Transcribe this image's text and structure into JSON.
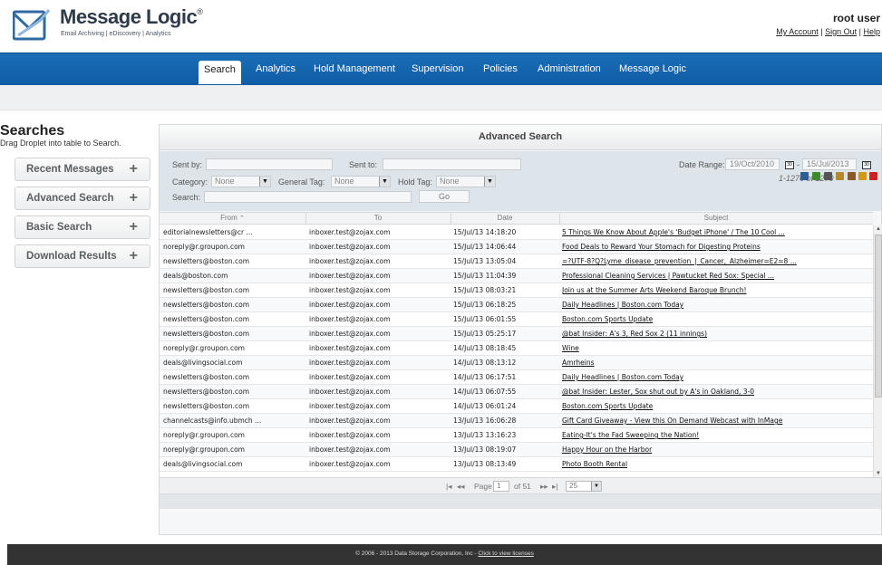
{
  "brand": {
    "title": "Message Logic",
    "trademark": "®",
    "tagline": "Email Archiving | eDiscovery | Analytics"
  },
  "user": {
    "name": "root user",
    "my_account": "My Account",
    "sign_out": "Sign Out",
    "help": "Help"
  },
  "nav": {
    "search": "Search",
    "analytics": "Analytics",
    "hold_management": "Hold Management",
    "supervision": "Supervision",
    "policies": "Policies",
    "administration": "Administration",
    "message_logic": "Message Logic"
  },
  "sidebar": {
    "title": "Searches",
    "subtitle": "Drag Droplet into table to Search.",
    "items": [
      {
        "label": "Recent Messages",
        "plus": "+"
      },
      {
        "label": "Advanced Search",
        "plus": "+"
      },
      {
        "label": "Basic Search",
        "plus": "+"
      },
      {
        "label": "Download Results",
        "plus": "+"
      }
    ]
  },
  "panel": {
    "title": "Advanced Search"
  },
  "filters": {
    "sent_by_label": "Sent by:",
    "sent_by_value": "",
    "sent_to_label": "Sent to:",
    "sent_to_value": "",
    "date_range_label": "Date Range:",
    "date_from": "19/Oct/2010",
    "date_sep": "-",
    "date_to": "15/Jul/2013",
    "category_label": "Category:",
    "category_value": "None",
    "general_tag_label": "General Tag:",
    "general_tag_value": "None",
    "hold_tag_label": "Hold Tag:",
    "hold_tag_value": "None",
    "search_label": "Search:",
    "search_value": "",
    "go_label": "Go",
    "results_count": "1-1270 of 1270",
    "calendar_icon_text": "30",
    "tool_icons": [
      {
        "name": "email-icon",
        "color": "#2a5f95"
      },
      {
        "name": "checklist-icon",
        "color": "#3d8a2e"
      },
      {
        "name": "print-icon",
        "color": "#555555"
      },
      {
        "name": "tag-icon",
        "color": "#b8862b"
      },
      {
        "name": "calendar-icon",
        "color": "#8a5a2b"
      },
      {
        "name": "refresh-icon",
        "color": "#d09a17"
      },
      {
        "name": "stop-icon",
        "color": "#cc2222"
      }
    ]
  },
  "table": {
    "columns": [
      "From",
      "To",
      "Date",
      "Subject"
    ],
    "sort_indicator": "⌃",
    "rows": [
      {
        "from": "editorialnewsletters@cr ...",
        "to": "inboxer.test@zojax.com",
        "date": "15/Jul/13 14:18:20",
        "subject": "5 Things We Know About Apple's 'Budget iPhone' / The 10 Cool ..."
      },
      {
        "from": "noreply@r.groupon.com",
        "to": "inboxer.test@zojax.com",
        "date": "15/Jul/13 14:06:44",
        "subject": "Food Deals to Reward Your Stomach for Digesting Proteins"
      },
      {
        "from": "newsletters@boston.com",
        "to": "inboxer.test@zojax.com",
        "date": "15/Jul/13 13:05:04",
        "subject": "=?UTF-8?Q?Lyme_disease_prevention_|_Cancer,_Alzheimer=E2=8 ..."
      },
      {
        "from": "deals@boston.com",
        "to": "inboxer.test@zojax.com",
        "date": "15/Jul/13 11:04:39",
        "subject": "Professional Cleaning Services | Pawtucket Red Sox: Special ..."
      },
      {
        "from": "newsletters@boston.com",
        "to": "inboxer.test@zojax.com",
        "date": "15/Jul/13 08:03:21",
        "subject": "Join us at the Summer Arts Weekend Baroque Brunch!"
      },
      {
        "from": "newsletters@boston.com",
        "to": "inboxer.test@zojax.com",
        "date": "15/Jul/13 06:18:25",
        "subject": "Daily Headlines | Boston.com Today"
      },
      {
        "from": "newsletters@boston.com",
        "to": "inboxer.test@zojax.com",
        "date": "15/Jul/13 06:01:55",
        "subject": "Boston.com Sports Update"
      },
      {
        "from": "newsletters@boston.com",
        "to": "inboxer.test@zojax.com",
        "date": "15/Jul/13 05:25:17",
        "subject": "@bat Insider: A's 3, Red Sox 2 (11 innings)"
      },
      {
        "from": "noreply@r.groupon.com",
        "to": "inboxer.test@zojax.com",
        "date": "14/Jul/13 08:18:45",
        "subject": "Wine"
      },
      {
        "from": "deals@livingsocial.com",
        "to": "inboxer.test@zojax.com",
        "date": "14/Jul/13 08:13:12",
        "subject": "Amrheins"
      },
      {
        "from": "newsletters@boston.com",
        "to": "inboxer.test@zojax.com",
        "date": "14/Jul/13 06:17:51",
        "subject": "Daily Headlines | Boston.com Today"
      },
      {
        "from": "newsletters@boston.com",
        "to": "inboxer.test@zojax.com",
        "date": "14/Jul/13 06:07:55",
        "subject": "@bat Insider: Lester, Sox shut out by A's in Oakland, 3-0"
      },
      {
        "from": "newsletters@boston.com",
        "to": "inboxer.test@zojax.com",
        "date": "14/Jul/13 06:01:24",
        "subject": "Boston.com Sports Update"
      },
      {
        "from": "channelcasts@info.ubmch ...",
        "to": "inboxer.test@zojax.com",
        "date": "13/Jul/13 16:06:28",
        "subject": "Gift Card Giveaway - View this On Demand Webcast with InMage"
      },
      {
        "from": "noreply@r.groupon.com",
        "to": "inboxer.test@zojax.com",
        "date": "13/Jul/13 13:16:23",
        "subject": "Eating-It's the Fad Sweeping the Nation!"
      },
      {
        "from": "noreply@r.groupon.com",
        "to": "inboxer.test@zojax.com",
        "date": "13/Jul/13 08:19:07",
        "subject": "Happy Hour on the Harbor"
      },
      {
        "from": "deals@livingsocial.com",
        "to": "inboxer.test@zojax.com",
        "date": "13/Jul/13 08:13:49",
        "subject": "Photo Booth Rental"
      }
    ]
  },
  "pager": {
    "first": "|◂",
    "prev": "◂◂",
    "page_label": "Page",
    "page_value": "1",
    "of_label": "of 51",
    "next": "▸▸",
    "last": "▸|",
    "page_size": "25"
  },
  "footer": {
    "text": "© 2006 - 2013 Data Storage Corporation, Inc -",
    "link": "Click to view licenses"
  },
  "colors": {
    "nav_blue": "#1a6eb8",
    "footer_dark": "#333333",
    "filter_bg": "#dde4ea"
  }
}
